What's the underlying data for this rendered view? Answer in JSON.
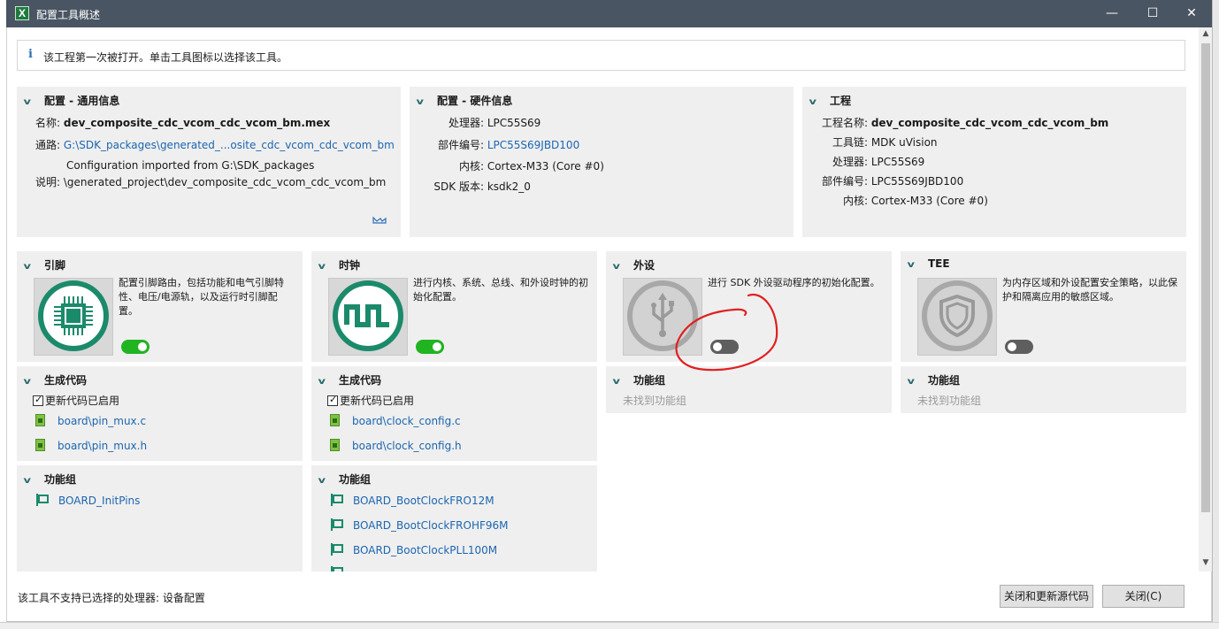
{
  "window": {
    "app_icon": "X",
    "title": "配置工具概述",
    "min_glyph": "—",
    "max_glyph": "☐",
    "close_glyph": "✕"
  },
  "info_bar": {
    "icon": "i",
    "text": "该工程第一次被打开。单击工具图标以选择该工具。"
  },
  "general": {
    "title": "配置 - 通用信息",
    "name_label": "名称:",
    "name_value": "dev_composite_cdc_vcom_cdc_vcom_bm.mex",
    "path_label": "通路:",
    "path_value": "G:\\SDK_packages\\generated_...osite_cdc_vcom_cdc_vcom_bm",
    "desc_label": "说明:",
    "desc_line1": "Configuration imported from G:\\SDK_packages",
    "desc_line2": "\\generated_project\\dev_composite_cdc_vcom_cdc_vcom_bm"
  },
  "hardware": {
    "title": "配置 - 硬件信息",
    "rows": [
      {
        "label": "处理器:",
        "value": "LPC55S69",
        "link": false
      },
      {
        "label": "部件编号:",
        "value": "LPC55S69JBD100",
        "link": true
      },
      {
        "label": "内核:",
        "value": "Cortex-M33 (Core #0)",
        "link": false
      },
      {
        "label": "SDK 版本:",
        "value": "ksdk2_0",
        "link": false
      }
    ]
  },
  "project": {
    "title": "工程",
    "rows": [
      {
        "label": "工程名称:",
        "value": "dev_composite_cdc_vcom_cdc_vcom_bm"
      },
      {
        "label": "工具链:",
        "value": "MDK uVision"
      },
      {
        "label": "处理器:",
        "value": "LPC55S69"
      },
      {
        "label": "部件编号:",
        "value": "LPC55S69JBD100"
      },
      {
        "label": "内核:",
        "value": "Cortex-M33 (Core #0)"
      }
    ]
  },
  "tools": {
    "pins": {
      "title": "引脚",
      "desc": "配置引脚路由，包括功能和电气引脚特性、电压/电源轨，以及运行时引脚配置。",
      "enabled": true,
      "codegen_title": "生成代码",
      "codegen_checkbox": "更新代码已启用",
      "files": [
        "board\\pin_mux.c",
        "board\\pin_mux.h"
      ],
      "groups_title": "功能组",
      "groups": [
        "BOARD_InitPins"
      ]
    },
    "clocks": {
      "title": "时钟",
      "desc": "进行内核、系统、总线、和外设时钟的初始化配置。",
      "enabled": true,
      "codegen_title": "生成代码",
      "codegen_checkbox": "更新代码已启用",
      "files": [
        "board\\clock_config.c",
        "board\\clock_config.h"
      ],
      "groups_title": "功能组",
      "groups": [
        "BOARD_BootClockFRO12M",
        "BOARD_BootClockFROHF96M",
        "BOARD_BootClockPLL100M"
      ]
    },
    "peripherals": {
      "title": "外设",
      "desc": "进行 SDK 外设驱动程序的初始化配置。",
      "enabled": false,
      "groups_title": "功能组",
      "groups_empty": "未找到功能组"
    },
    "tee": {
      "title": "TEE",
      "desc": "为内存区域和外设配置安全策略，以此保护和隔离应用的敏感区域。",
      "enabled": false,
      "groups_title": "功能组",
      "groups_empty": "未找到功能组"
    }
  },
  "scrollbar": {
    "up": "▲",
    "down": "▼"
  },
  "footer": {
    "text": "该工具不支持已选择的处理器: 设备配置",
    "close_update_label": "关闭和更新源代码",
    "close_label": "关闭(C)"
  },
  "colors": {
    "titlebar": "#4a5563",
    "panel": "#efefef",
    "accent_teal": "#1b8a6b",
    "link": "#1c66b0",
    "toggle_on": "#21b421",
    "toggle_off": "#5e5e5e",
    "annotation": "#e02020"
  }
}
